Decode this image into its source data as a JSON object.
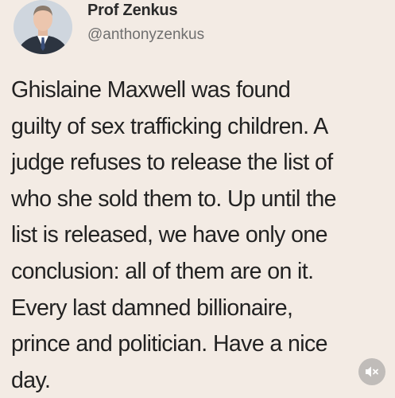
{
  "author": {
    "display_name": "Prof Zenkus",
    "handle": "@anthonyzenkus",
    "avatar_icon": "profile-photo"
  },
  "tweet": {
    "text": "Ghislaine Maxwell was found\nguilty of sex trafficking children. A\njudge refuses to release the list of\nwho she sold them to. Up until the\nlist is released, we have only one\nconclusion: all of them are on it.\nEvery last damned billionaire,\nprince and politician. Have a nice\nday."
  },
  "controls": {
    "mute_icon": "speaker-muted-icon"
  },
  "colors": {
    "background": "#f3ebe4",
    "text": "#222222",
    "handle": "#6f6f6f"
  }
}
